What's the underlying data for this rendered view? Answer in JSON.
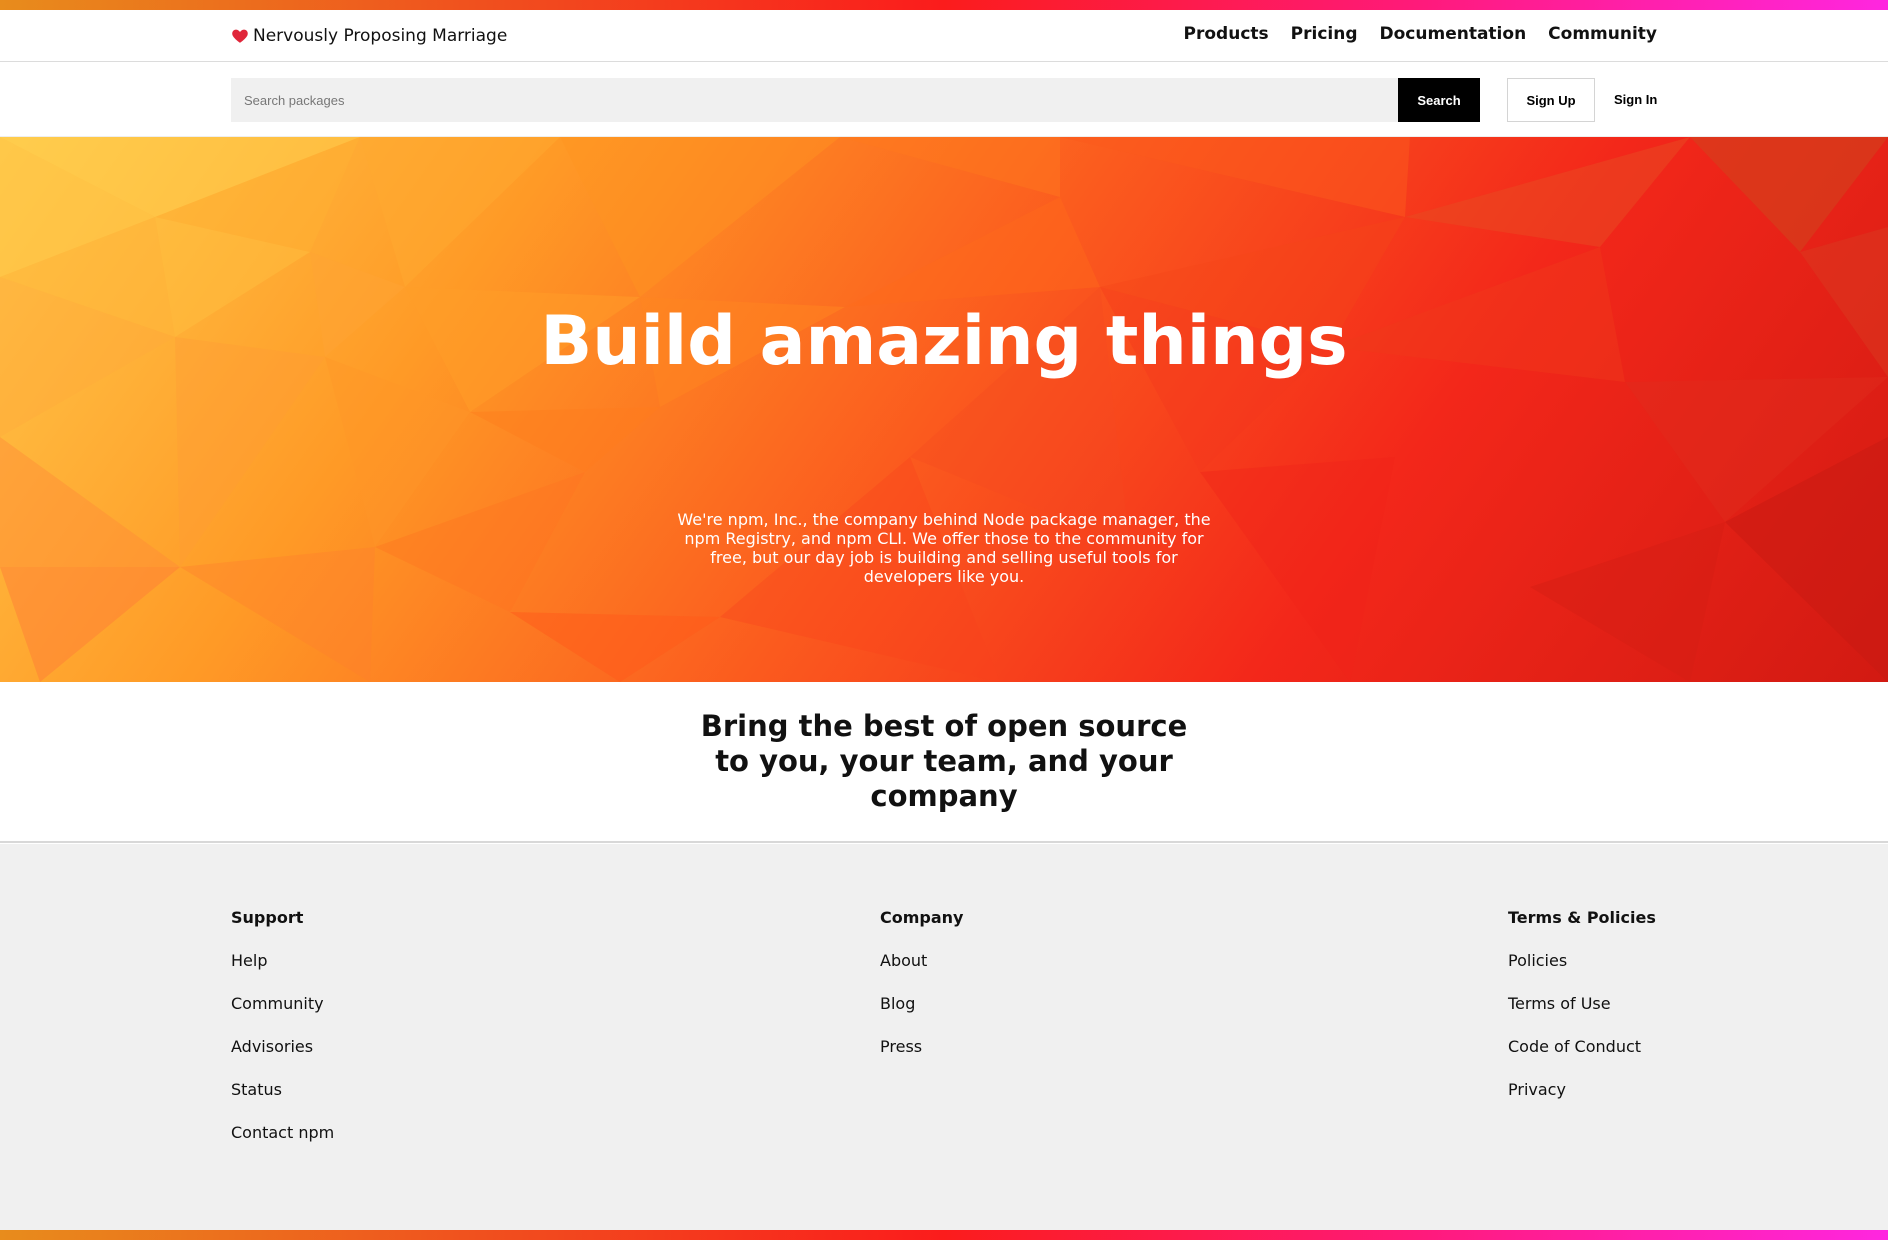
{
  "brand": {
    "name": "Nervously Proposing Marriage",
    "icon": "heart-icon"
  },
  "nav": {
    "items": [
      "Products",
      "Pricing",
      "Documentation",
      "Community"
    ]
  },
  "search": {
    "placeholder": "Search packages",
    "button_label": "Search"
  },
  "auth": {
    "signup_label": "Sign Up",
    "signin_label": "Sign In"
  },
  "hero": {
    "title": "Build amazing things",
    "text": "We're npm, Inc., the company behind Node package manager, the npm Registry, and npm CLI. We offer those to the community for free, but our day job is building and selling useful tools for developers like you."
  },
  "tagline": "Bring the best of open source to you, your team, and your company",
  "footer": {
    "columns": [
      {
        "heading": "Support",
        "links": [
          "Help",
          "Community",
          "Advisories",
          "Status",
          "Contact npm"
        ]
      },
      {
        "heading": "Company",
        "links": [
          "About",
          "Blog",
          "Press"
        ]
      },
      {
        "heading": "Terms & Policies",
        "links": [
          "Policies",
          "Terms of Use",
          "Code of Conduct",
          "Privacy"
        ]
      }
    ]
  },
  "colors": {
    "accent_gradient_start": "#e88c1c",
    "accent_gradient_end": "#ff26e0",
    "heart": "#e0263a"
  }
}
